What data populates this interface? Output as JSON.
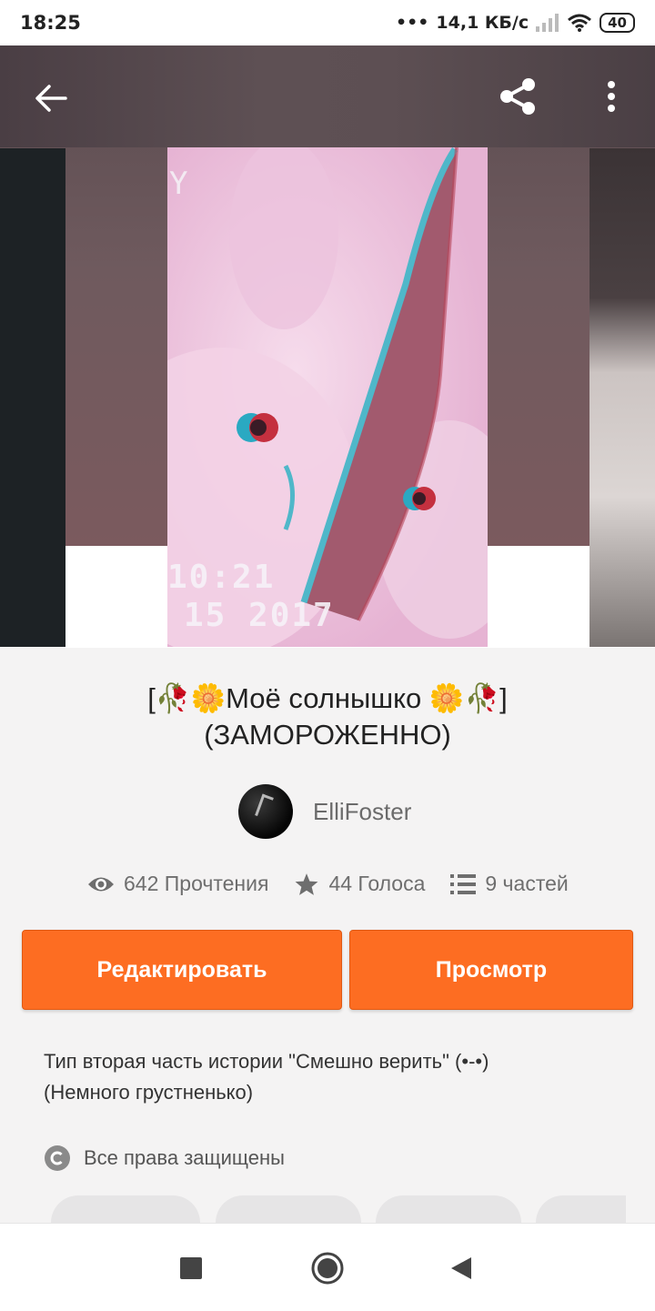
{
  "status_bar": {
    "time": "18:25",
    "network_speed": "14,1 КБ/с",
    "battery": "40"
  },
  "top_bar": {
    "back_icon": "arrow-left-icon",
    "share_icon": "share-icon",
    "more_icon": "more-vertical-icon"
  },
  "cover": {
    "overlay_time": "10:21",
    "overlay_date": "15 2017",
    "overlay_letter": "Y"
  },
  "story": {
    "title_line1": "[🥀🌼Моё солнышко 🌼🥀]",
    "title_line2": "(ЗАМОРОЖЕННО)",
    "author": "ElliFoster",
    "reads": "642 Прочтения",
    "votes": "44 Голоса",
    "parts": "9 частей",
    "description_line1": "Тип вторая часть истории \"Смешно верить\" (•-•)",
    "description_line2": "(Немного грустненько)",
    "copyright": "Все права защищены"
  },
  "actions": {
    "edit_label": "Редактировать",
    "preview_label": "Просмотр"
  },
  "colors": {
    "accent": "#fd6d22",
    "status_bar_bg": "#ffffff",
    "hero_bg": "#6f5a5e"
  }
}
